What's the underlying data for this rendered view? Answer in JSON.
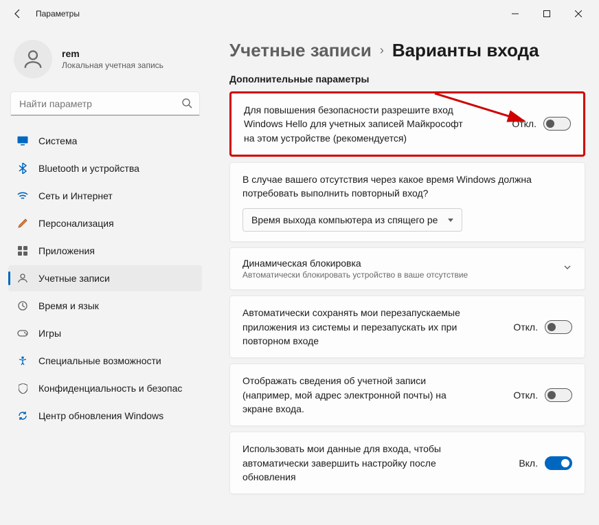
{
  "titlebar": {
    "title": "Параметры"
  },
  "profile": {
    "name": "rem",
    "subtitle": "Локальная учетная запись"
  },
  "search": {
    "placeholder": "Найти параметр"
  },
  "nav": [
    {
      "label": "Система"
    },
    {
      "label": "Bluetooth и устройства"
    },
    {
      "label": "Сеть и Интернет"
    },
    {
      "label": "Персонализация"
    },
    {
      "label": "Приложения"
    },
    {
      "label": "Учетные записи"
    },
    {
      "label": "Время и язык"
    },
    {
      "label": "Игры"
    },
    {
      "label": "Специальные возможности"
    },
    {
      "label": "Конфиденциальность и безопас"
    },
    {
      "label": "Центр обновления Windows"
    }
  ],
  "breadcrumb": {
    "parent": "Учетные записи",
    "current": "Варианты входа"
  },
  "section": {
    "title": "Дополнительные параметры"
  },
  "cards": {
    "hello": {
      "text": "Для повышения безопасности разрешите вход Windows Hello для учетных записей Майкрософт на этом устройстве (рекомендуется)",
      "state": "Откл."
    },
    "reauth": {
      "text": "В случае вашего отсутствия через какое время Windows должна потребовать выполнить повторный вход?",
      "dropdown": "Время выхода компьютера из спящего ре"
    },
    "dynlock": {
      "title": "Динамическая блокировка",
      "sub": "Автоматически блокировать устройство в ваше отсутствие"
    },
    "restart": {
      "text": "Автоматически сохранять мои перезапускаемые приложения из системы и перезапускать их при повторном входе",
      "state": "Откл."
    },
    "account_info": {
      "text": "Отображать сведения об учетной записи (например, мой адрес электронной почты) на экране входа.",
      "state": "Откл."
    },
    "finish_setup": {
      "text": "Использовать мои данные для входа, чтобы автоматически завершить настройку после обновления",
      "state": "Вкл."
    }
  }
}
